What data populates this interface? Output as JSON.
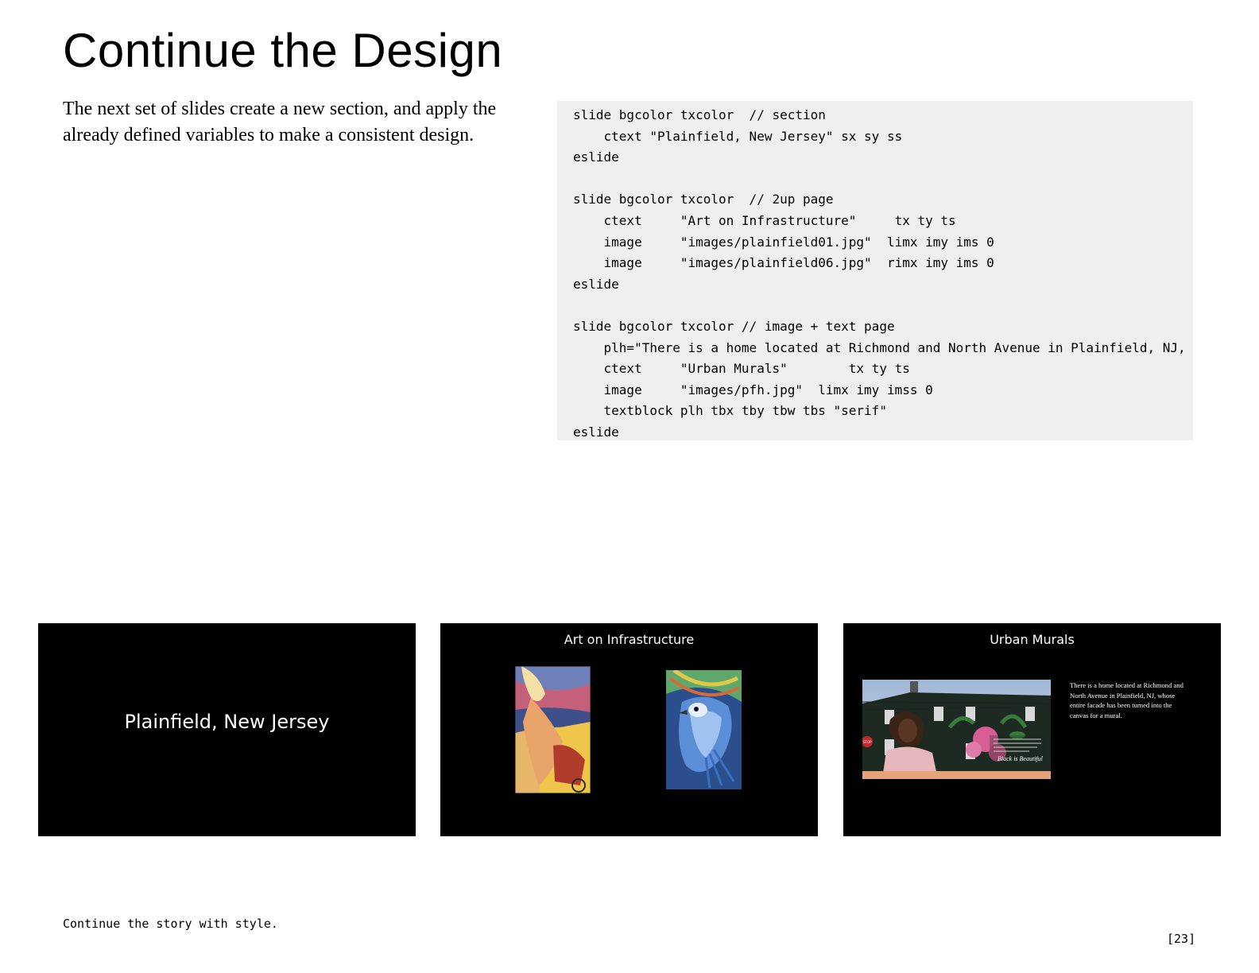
{
  "page": {
    "title": "Continue the Design",
    "intro": "The next set of slides create a new section, and apply the already defined variables to make a consistent design.",
    "code": "slide bgcolor txcolor  // section\n    ctext \"Plainfield, New Jersey\" sx sy ss\neslide\n\nslide bgcolor txcolor  // 2up page\n    ctext     \"Art on Infrastructure\"     tx ty ts\n    image     \"images/plainfield01.jpg\"  limx imy ims 0\n    image     \"images/plainfield06.jpg\"  rimx imy ims 0\neslide\n\nslide bgcolor txcolor // image + text page\n    plh=\"There is a home located at Richmond and North Avenue in Plainfield, NJ, whose enti\n    ctext     \"Urban Murals\"        tx ty ts\n    image     \"images/pfh.jpg\"  limx imy imss 0\n    textblock plh tbx tby tbw tbs \"serif\"\neslide",
    "footer": "Continue the story with style.",
    "page_number": "[23]"
  },
  "slides": [
    {
      "text": "Plainfield, New Jersey"
    },
    {
      "title": "Art on Infrastructure"
    },
    {
      "title": "Urban Murals",
      "body": "There is a home located at Richmond and North Avenue in Plainfield, NJ, whose entire facade has been turned into the canvas for a mural."
    }
  ],
  "mural": {
    "signature": "Black is Beautiful",
    "stop_sign": "STOP"
  },
  "colors": {
    "slide_background": "#000000",
    "code_background": "#efefef",
    "text": "#000000"
  }
}
